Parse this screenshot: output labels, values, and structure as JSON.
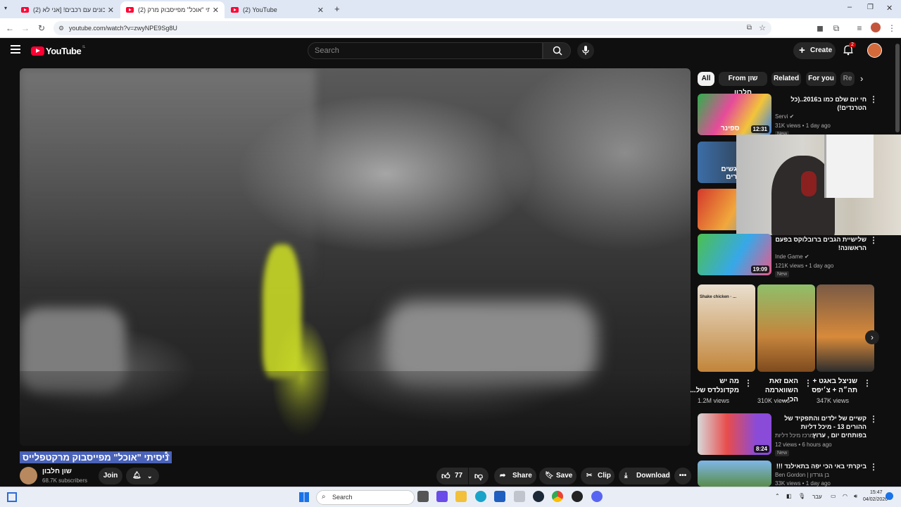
{
  "browser": {
    "tabs": [
      {
        "title": "(2) מתכונים עם רכבים! [אני לא",
        "active": false
      },
      {
        "title": "(2) ניסיתי \"אוכל\" מפייסבוק מרק",
        "active": true
      },
      {
        "title": "(2) YouTube",
        "active": false
      }
    ],
    "url": "youtube.com/watch?v=zwyNPE9Sg8U"
  },
  "yt": {
    "logo": "YouTube",
    "logo_country": "IL",
    "search_placeholder": "Search",
    "create_label": "Create",
    "notif_count": "2"
  },
  "video": {
    "title": "ניסיתי \"אוכל\" מפייסבוק מרקטפלייס",
    "channel": "שון חלבון",
    "subscribers": "68.7K subscribers",
    "join_label": "Join",
    "likes": "77",
    "share_label": "Share",
    "save_label": "Save",
    "clip_label": "Clip",
    "download_label": "Download"
  },
  "sidebar": {
    "chips": [
      "All",
      "From שון חלבון",
      "Related",
      "For you",
      "Re"
    ],
    "videos": [
      {
        "title": "חי יום שלם כמו ב2016..(כל הטרנדים!)",
        "channel": "Servi",
        "meta": "31K views • 1 day ago",
        "duration": "12:31",
        "new": "New",
        "thumb_text": "ספינר"
      },
      {
        "title": "שלישיית הגבים ברובלוקס בפעם הראשונה!",
        "channel": "Inde Game",
        "meta": "121K views • 1 day ago",
        "duration": "19:09",
        "new": "New"
      },
      {
        "title": "קשיים של ילדים והתפקיד של ההורים 13 - מיכל דליות בפותחים יום , ערוץ",
        "channel": "מרכז מיכל דליות",
        "meta": "12 views • 6 hours ago",
        "duration": "8:24",
        "new": "New"
      },
      {
        "title": "ביקרתי באי הכי יפה בתאילנד !!!",
        "channel": "Ben Gordon | בן גורדון",
        "meta": "33K views • 1 day ago"
      }
    ],
    "second_thumb_text": "גשים רים",
    "shorts": [
      {
        "title": "מה יש מקדונלדס של...",
        "views": "1.2M views",
        "overlay": "Shake chicken · ..."
      },
      {
        "title": "האם זאת השווארמה הכי...",
        "views": "310K views"
      },
      {
        "title": "שניצל באגט + תה״ה + צ׳יפס",
        "views": "347K views"
      }
    ]
  },
  "taskbar": {
    "search_placeholder": "Search",
    "lang": "עבר",
    "time": "15:47",
    "date": "04/02/2026"
  }
}
